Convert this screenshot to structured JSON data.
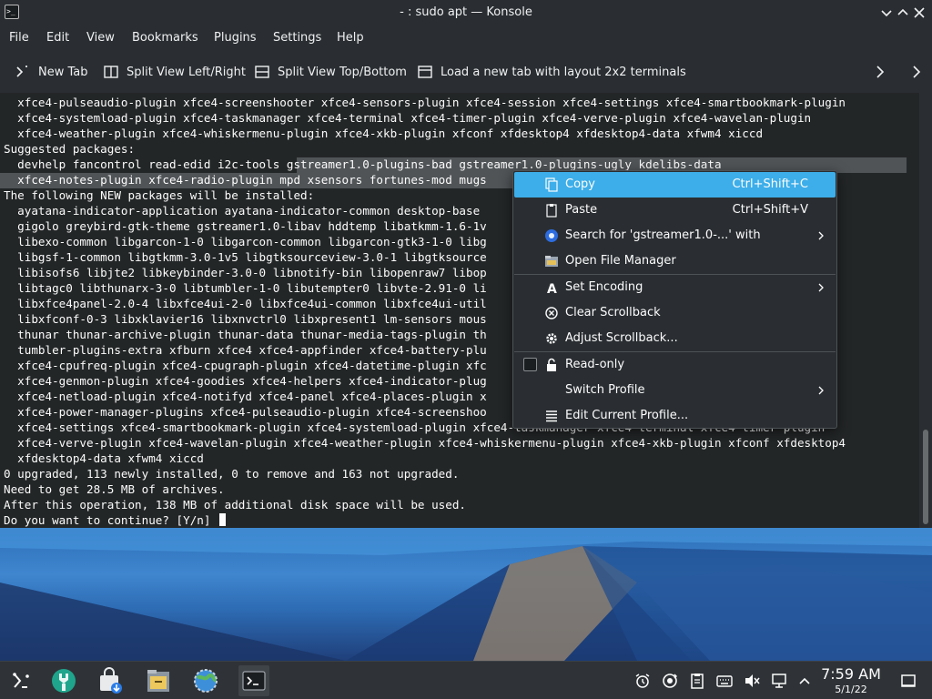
{
  "window": {
    "title": "- : sudo apt — Konsole"
  },
  "menubar": {
    "items": [
      "File",
      "Edit",
      "View",
      "Bookmarks",
      "Plugins",
      "Settings",
      "Help"
    ]
  },
  "toolbar": {
    "new_tab": "New Tab",
    "split_lr": "Split View Left/Right",
    "split_tb": "Split View Top/Bottom",
    "layout_2x2": "Load a new tab with layout 2x2 terminals"
  },
  "terminal": {
    "lines": [
      "  xfce4-pulseaudio-plugin xfce4-screenshooter xfce4-sensors-plugin xfce4-session xfce4-settings xfce4-smartbookmark-plugin",
      "  xfce4-systemload-plugin xfce4-taskmanager xfce4-terminal xfce4-timer-plugin xfce4-verve-plugin xfce4-wavelan-plugin",
      "  xfce4-weather-plugin xfce4-whiskermenu-plugin xfce4-xkb-plugin xfconf xfdesktop4 xfdesktop4-data xfwm4 xiccd",
      "Suggested packages:",
      "  devhelp fancontrol read-edid i2c-tools gstreamer1.0-plugins-bad gstreamer1.0-plugins-ugly kdelibs-data",
      "  xfce4-notes-plugin xfce4-radio-plugin mpd xsensors fortunes-mod mugs",
      "The following NEW packages will be installed:",
      "  ayatana-indicator-application ayatana-indicator-common desktop-base                                  uicksand",
      "  gigolo greybird-gtk-theme gstreamer1.0-libav hddtemp libatkmm-1.6-1v",
      "  libexo-common libgarcon-1-0 libgarcon-common libgarcon-gtk3-1-0 libg",
      "  libgsf-1-common libgtkmm-3.0-1v5 libgtksourceview-3.0-1 libgtksource                                  on",
      "  libisofs6 libjte2 libkeybinder-3.0-0 libnotify-bin libopenraw7 libop                                  -0v5",
      "  libtagc0 libthunarx-3-0 libtumbler-1-0 libutempter0 libvte-2.91-0 li",
      "  libxfce4panel-2.0-4 libxfce4ui-2-0 libxfce4ui-common libxfce4ui-util                                  ce4util7",
      "  libxfconf-0-3 libxklavier16 libxnvctrl0 libxpresent1 lm-sensors mous                                  -theme",
      "  thunar thunar-archive-plugin thunar-data thunar-media-tags-plugin th",
      "  tumbler-plugins-extra xfburn xfce4 xfce4-appfinder xfce4-battery-plu",
      "  xfce4-cpufreq-plugin xfce4-cpugraph-plugin xfce4-datetime-plugin xfc                                  plugin",
      "  xfce4-genmon-plugin xfce4-goodies xfce4-helpers xfce4-indicator-plug",
      "  xfce4-netload-plugin xfce4-notifyd xfce4-panel xfce4-places-plugin x",
      "  xfce4-power-manager-plugins xfce4-pulseaudio-plugin xfce4-screenshoo",
      "  xfce4-settings xfce4-smartbookmark-plugin xfce4-systemload-plugin xfce4-taskmanager xfce4-terminal xfce4-timer-plugin",
      "  xfce4-verve-plugin xfce4-wavelan-plugin xfce4-weather-plugin xfce4-whiskermenu-plugin xfce4-xkb-plugin xfconf xfdesktop4",
      "  xfdesktop4-data xfwm4 xiccd",
      "0 upgraded, 113 newly installed, 0 to remove and 163 not upgraded.",
      "Need to get 28.5 MB of archives.",
      "After this operation, 138 MB of additional disk space will be used."
    ],
    "prompt": "Do you want to continue? [Y/n]"
  },
  "context_menu": {
    "copy": "Copy",
    "copy_shortcut": "Ctrl+Shift+C",
    "paste": "Paste",
    "paste_shortcut": "Ctrl+Shift+V",
    "search": "Search for 'gstreamer1.0-...' with",
    "open_file_manager": "Open File Manager",
    "set_encoding": "Set Encoding",
    "clear_scrollback": "Clear Scrollback",
    "adjust_scrollback": "Adjust Scrollback...",
    "read_only": "Read-only",
    "switch_profile": "Switch Profile",
    "edit_profile": "Edit Current Profile..."
  },
  "taskbar": {
    "time": "7:59 AM",
    "date": "5/1/22"
  },
  "colors": {
    "highlight": "#3daee9",
    "terminal_bg": "#232627",
    "window_bg": "#2a2e32",
    "selection": "#505457"
  }
}
